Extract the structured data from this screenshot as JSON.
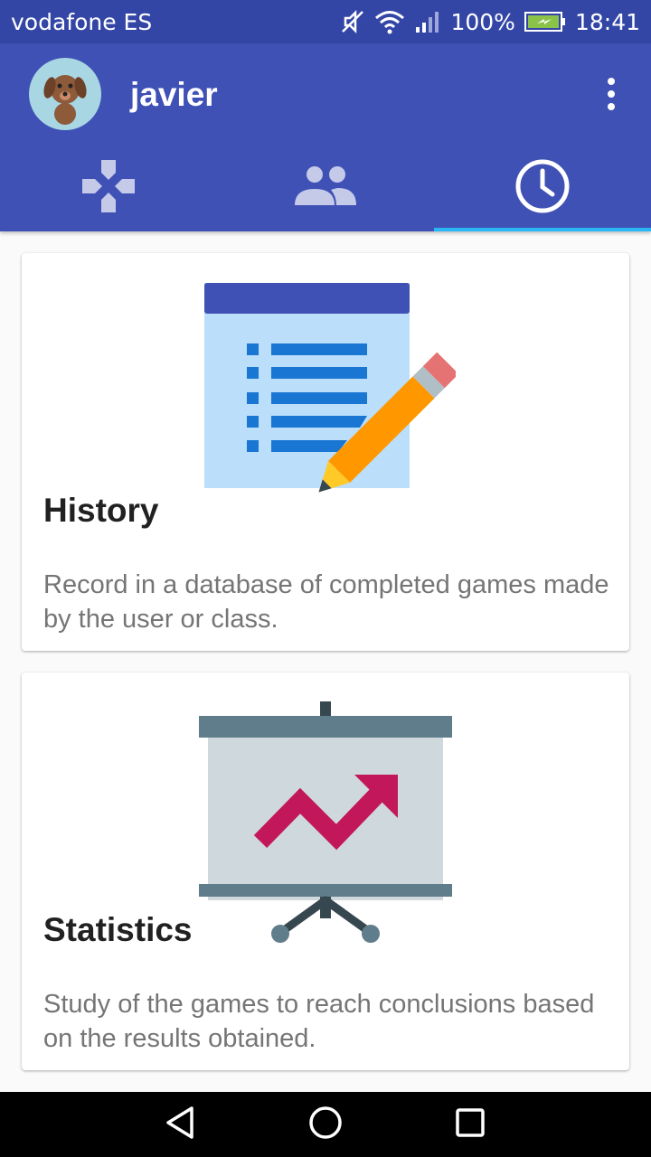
{
  "status_bar": {
    "carrier": "vodafone ES",
    "battery": "100%",
    "time": "18:41"
  },
  "header": {
    "username": "javier",
    "avatar_icon": "dog-avatar-icon",
    "menu_icon": "more-vert-icon"
  },
  "tabs": [
    {
      "icon": "gamepad-icon",
      "active": false
    },
    {
      "icon": "people-icon",
      "active": false
    },
    {
      "icon": "clock-icon",
      "active": true
    }
  ],
  "cards": [
    {
      "title": "History",
      "description": "Record in a database of completed games made by the user or class.",
      "icon": "document-pencil-icon"
    },
    {
      "title": "Statistics",
      "description": "Study of the games to reach conclusions based on the results obtained.",
      "icon": "presentation-chart-icon"
    }
  ],
  "colors": {
    "primary": "#3f51b5",
    "primary_dark": "#3346a6",
    "tab_indicator": "#29b6f6",
    "chart_line": "#c2185b",
    "pencil": "#ff9800"
  }
}
